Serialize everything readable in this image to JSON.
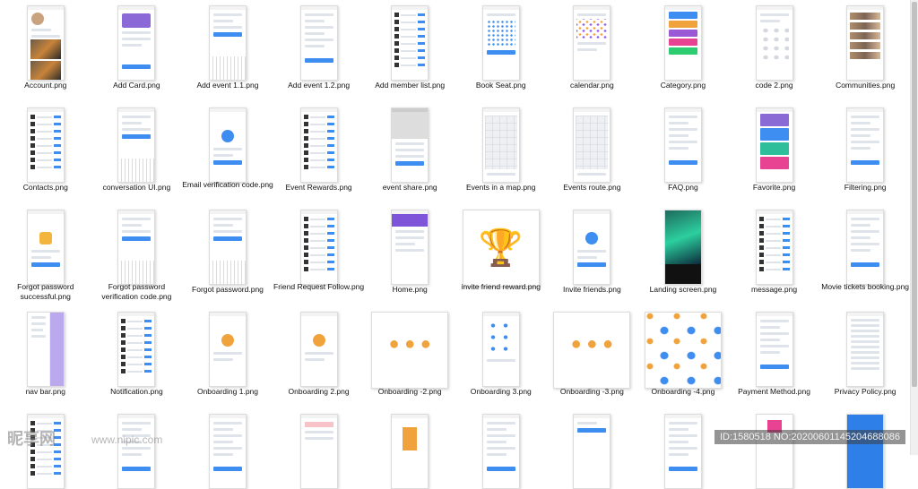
{
  "files": [
    {
      "name": "Account.png",
      "style": "account"
    },
    {
      "name": "Add Card.png",
      "style": "card"
    },
    {
      "name": "Add event 1.1.png",
      "style": "keyboard"
    },
    {
      "name": "Add event 1.2.png",
      "style": "form"
    },
    {
      "name": "Add member list.png",
      "style": "list"
    },
    {
      "name": "Book Seat.png",
      "style": "seat"
    },
    {
      "name": "calendar.png",
      "style": "calendar"
    },
    {
      "name": "Category.png",
      "style": "category"
    },
    {
      "name": "code 2.png",
      "style": "code"
    },
    {
      "name": "Communities.png",
      "style": "photos"
    },
    {
      "name": "Contacts.png",
      "style": "list"
    },
    {
      "name": "conversation UI.png",
      "style": "keyboard"
    },
    {
      "name": "Email verification code.png",
      "style": "email"
    },
    {
      "name": "Event Rewards.png",
      "style": "list"
    },
    {
      "name": "event share.png",
      "style": "share"
    },
    {
      "name": "Events in a map.png",
      "style": "map"
    },
    {
      "name": "Events route.png",
      "style": "map"
    },
    {
      "name": "FAQ.png",
      "style": "form"
    },
    {
      "name": "Favorite.png",
      "style": "favorite"
    },
    {
      "name": "Filtering.png",
      "style": "form"
    },
    {
      "name": "Forgot password successful.png",
      "style": "lock"
    },
    {
      "name": "Forgot password verification code.png",
      "style": "keyboard"
    },
    {
      "name": "Forgot password.png",
      "style": "keyboard"
    },
    {
      "name": "Friend Request Follow.png",
      "style": "list"
    },
    {
      "name": "Home.png",
      "style": "home"
    },
    {
      "name": "invite friend reward.png",
      "style": "trophy"
    },
    {
      "name": "Invite friends.png",
      "style": "email"
    },
    {
      "name": "Landing screen.png",
      "style": "landing"
    },
    {
      "name": "message.png",
      "style": "list"
    },
    {
      "name": "Movie tickets booking.png",
      "style": "form"
    },
    {
      "name": "nav bar.png",
      "style": "nav"
    },
    {
      "name": "Notification.png",
      "style": "list"
    },
    {
      "name": "Onboarding 1.png",
      "style": "onboard"
    },
    {
      "name": "Onboarding 2.png",
      "style": "onboard"
    },
    {
      "name": "Onboarding -2.png",
      "style": "onboardwide"
    },
    {
      "name": "Onboarding 3.png",
      "style": "people"
    },
    {
      "name": "Onboarding -3.png",
      "style": "onboardwide"
    },
    {
      "name": "Onboarding -4.png",
      "style": "peoplewide"
    },
    {
      "name": "Payment Method.png",
      "style": "form"
    },
    {
      "name": "Privacy Policy.png",
      "style": "text"
    },
    {
      "name": "",
      "style": "list"
    },
    {
      "name": "",
      "style": "form"
    },
    {
      "name": "",
      "style": "form"
    },
    {
      "name": "",
      "style": "pink"
    },
    {
      "name": "",
      "style": "door"
    },
    {
      "name": "",
      "style": "form"
    },
    {
      "name": "",
      "style": "welcome"
    },
    {
      "name": "",
      "style": "form"
    },
    {
      "name": "",
      "style": "pinkbar"
    },
    {
      "name": "",
      "style": "bluefull"
    }
  ],
  "watermark": {
    "logo": "昵享网",
    "url": "www.nipic.com",
    "id": "ID:1580518 NO:20200601145204688086"
  }
}
